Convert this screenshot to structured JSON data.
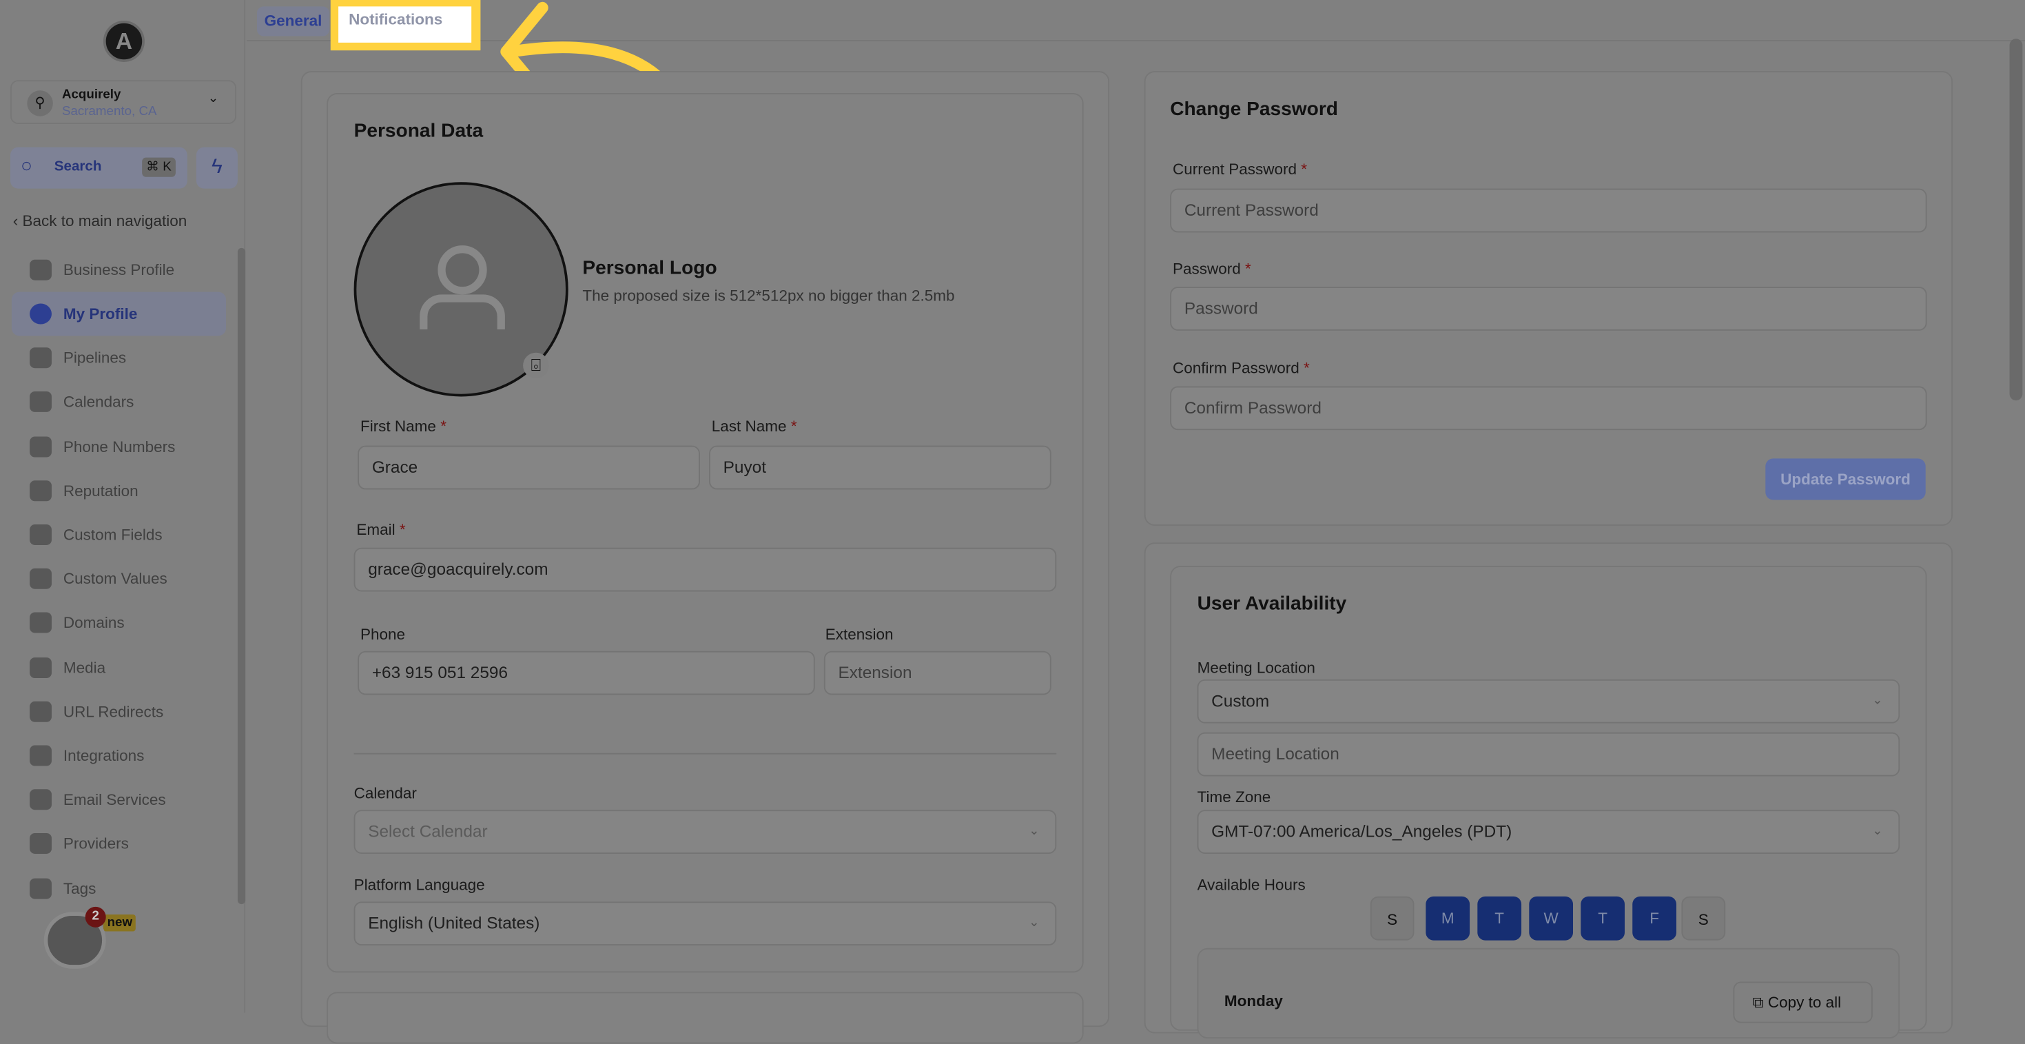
{
  "sidebar": {
    "logo": "A",
    "business": {
      "name": "Acquirely",
      "location": "Sacramento, CA"
    },
    "search": {
      "label": "Search",
      "shortcut": "⌘ K"
    },
    "back": "Back to main navigation",
    "items": [
      {
        "label": "Business Profile"
      },
      {
        "label": "My Profile",
        "active": true
      },
      {
        "label": "Pipelines"
      },
      {
        "label": "Calendars"
      },
      {
        "label": "Phone Numbers"
      },
      {
        "label": "Reputation"
      },
      {
        "label": "Custom Fields"
      },
      {
        "label": "Custom Values"
      },
      {
        "label": "Domains"
      },
      {
        "label": "Media"
      },
      {
        "label": "URL Redirects"
      },
      {
        "label": "Integrations"
      },
      {
        "label": "Email Services"
      },
      {
        "label": "Providers"
      },
      {
        "label": "Tags"
      }
    ],
    "chat_badge": "2",
    "new_badge": "new"
  },
  "tabs": {
    "general": "General",
    "notifications": "Notifications"
  },
  "personal": {
    "title": "Personal Data",
    "logo_title": "Personal Logo",
    "logo_hint": "The proposed size is 512*512px no bigger than 2.5mb",
    "first_name_label": "First Name",
    "first_name": "Grace",
    "last_name_label": "Last Name",
    "last_name": "Puyot",
    "email_label": "Email",
    "email": "grace@goacquirely.com",
    "phone_label": "Phone",
    "phone": "+63 915 051 2596",
    "extension_label": "Extension",
    "extension_placeholder": "Extension",
    "calendar_label": "Calendar",
    "calendar_placeholder": "Select Calendar",
    "language_label": "Platform Language",
    "language": "English (United States)"
  },
  "password": {
    "title": "Change Password",
    "current_label": "Current Password",
    "current_placeholder": "Current Password",
    "password_label": "Password",
    "password_placeholder": "Password",
    "confirm_label": "Confirm Password",
    "confirm_placeholder": "Confirm Password",
    "update": "Update Password"
  },
  "availability": {
    "title": "User Availability",
    "meeting_label": "Meeting Location",
    "meeting_type": "Custom",
    "meeting_placeholder": "Meeting Location",
    "tz_label": "Time Zone",
    "tz": "GMT-07:00 America/Los_Angeles (PDT)",
    "hours_label": "Available Hours",
    "days": [
      {
        "d": "S",
        "on": false
      },
      {
        "d": "M",
        "on": true
      },
      {
        "d": "T",
        "on": true
      },
      {
        "d": "W",
        "on": true
      },
      {
        "d": "T",
        "on": true
      },
      {
        "d": "F",
        "on": true
      },
      {
        "d": "S",
        "on": false
      }
    ],
    "monday": "Monday",
    "copy": "Copy to all"
  },
  "colors": {
    "highlight": "#ffd23f",
    "accent": "#2d3f92",
    "overlay": "#808080"
  }
}
